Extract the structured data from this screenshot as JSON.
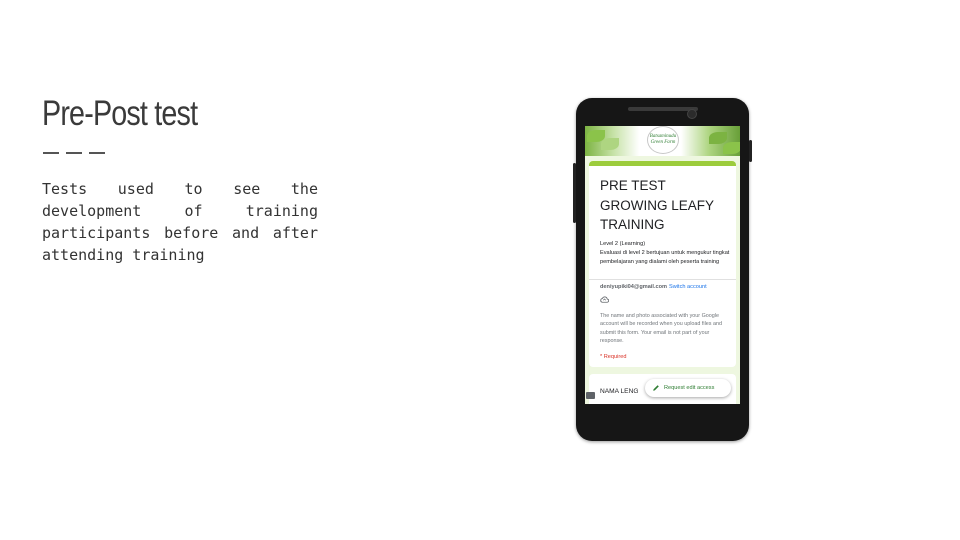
{
  "slide": {
    "title": "Pre-Post test",
    "body": "Tests used to see the development of training participants before and after attending training"
  },
  "phone": {
    "logo_lines": [
      "Batsaminudu",
      "Green Farm"
    ],
    "form": {
      "title": "PRE TEST GROWING LEAFY TRAINING",
      "desc_line1": "Level 2 (Learning)",
      "desc_line2": "Evaluasi di level 2 bertujuan untuk mengukur tingkat pembelajaran yang dialami oleh peserta training",
      "email": "deniyupiki04@gmail.com",
      "switch_account": "Switch account",
      "notice": "The name and photo associated with your Google account will be recorded when you upload files and submit this form. Your email is not part of your response.",
      "required": "* Required",
      "field_label": "NAMA LENG",
      "request_edit": "Request edit access"
    }
  },
  "colors": {
    "accent_green": "#9ccc3c",
    "link_blue": "#1a73e8",
    "required_red": "#d93025"
  },
  "icons": [
    "cloud-save-icon",
    "pencil-icon",
    "report-icon"
  ]
}
